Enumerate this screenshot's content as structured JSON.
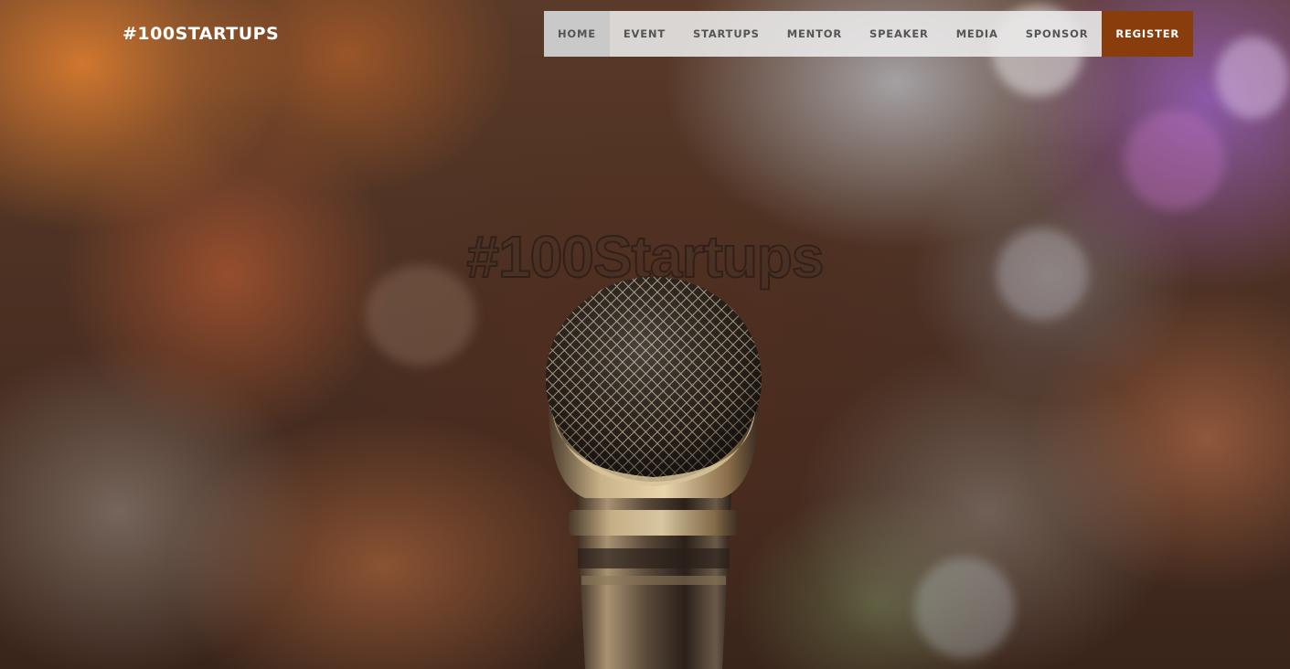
{
  "header": {
    "brand": "#100STARTUPS",
    "nav": [
      {
        "label": "HOME",
        "id": "home",
        "active": true
      },
      {
        "label": "EVENT",
        "id": "event"
      },
      {
        "label": "STARTUPS",
        "id": "startups"
      },
      {
        "label": "MENTOR",
        "id": "mentor"
      },
      {
        "label": "SPEAKER",
        "id": "speaker"
      },
      {
        "label": "MEDIA",
        "id": "media"
      },
      {
        "label": "SPONSOR",
        "id": "sponsor"
      },
      {
        "label": "REGISTER",
        "id": "register",
        "cta": true
      }
    ]
  },
  "hero": {
    "headline": "#100Startups",
    "image": "microphone-image"
  },
  "colors": {
    "accent": "#8a3d0c",
    "brand_text": "#ffffff",
    "nav_text": "#555555"
  }
}
